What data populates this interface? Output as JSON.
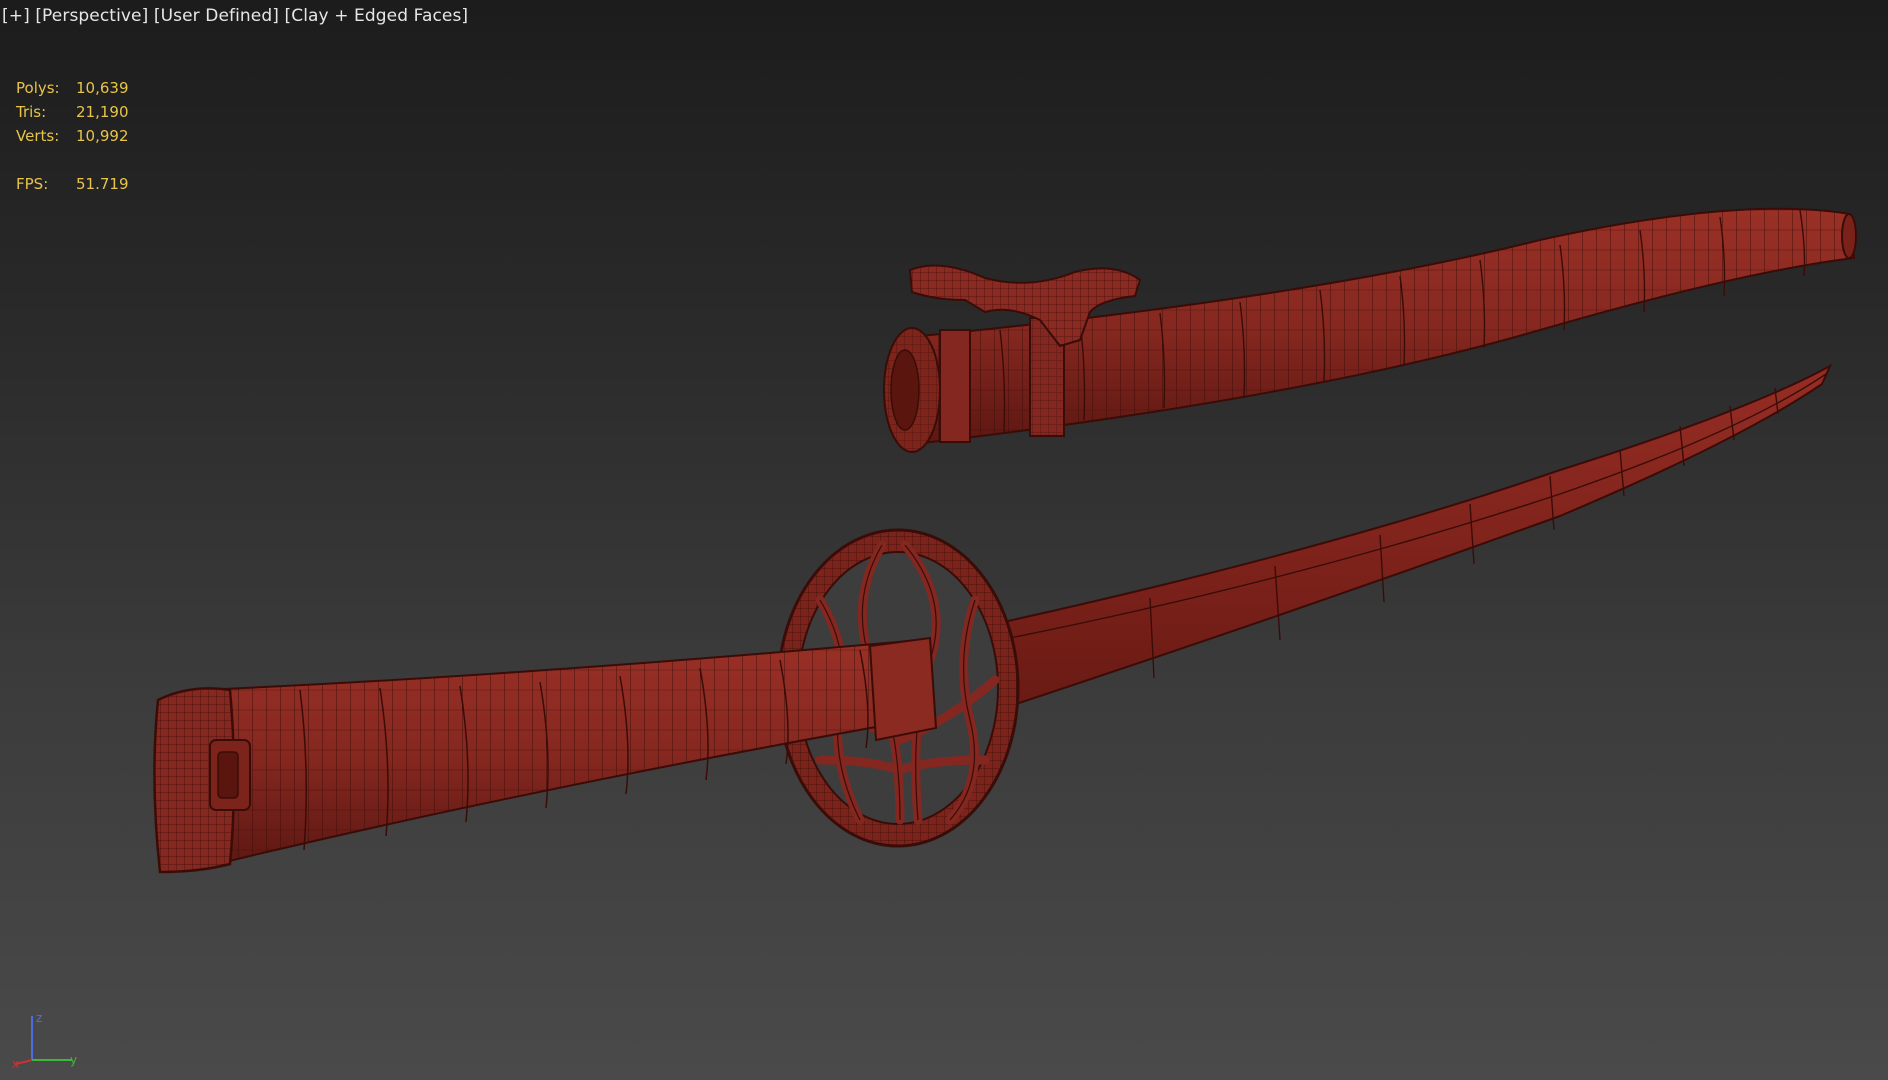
{
  "viewport": {
    "labels": {
      "plus": "[+]",
      "view": "[Perspective]",
      "camera": "[User Defined]",
      "shading": "[Clay + Edged Faces]"
    },
    "stats": {
      "polys_label": "Polys:",
      "polys_value": "10,639",
      "tris_label": "Tris:",
      "tris_value": "21,190",
      "verts_label": "Verts:",
      "verts_value": "10,992",
      "fps_label": "FPS:",
      "fps_value": "51.719"
    },
    "axis": {
      "z": "z",
      "x": "x",
      "y": "y"
    }
  },
  "colors": {
    "model": "#8b2a22",
    "model_shadow": "#5e1712",
    "wire": "#3a0c08",
    "stats_text": "#e8c44a",
    "axis_x": "#d03030",
    "axis_y": "#3cb83c",
    "axis_z": "#4a6ee0"
  }
}
